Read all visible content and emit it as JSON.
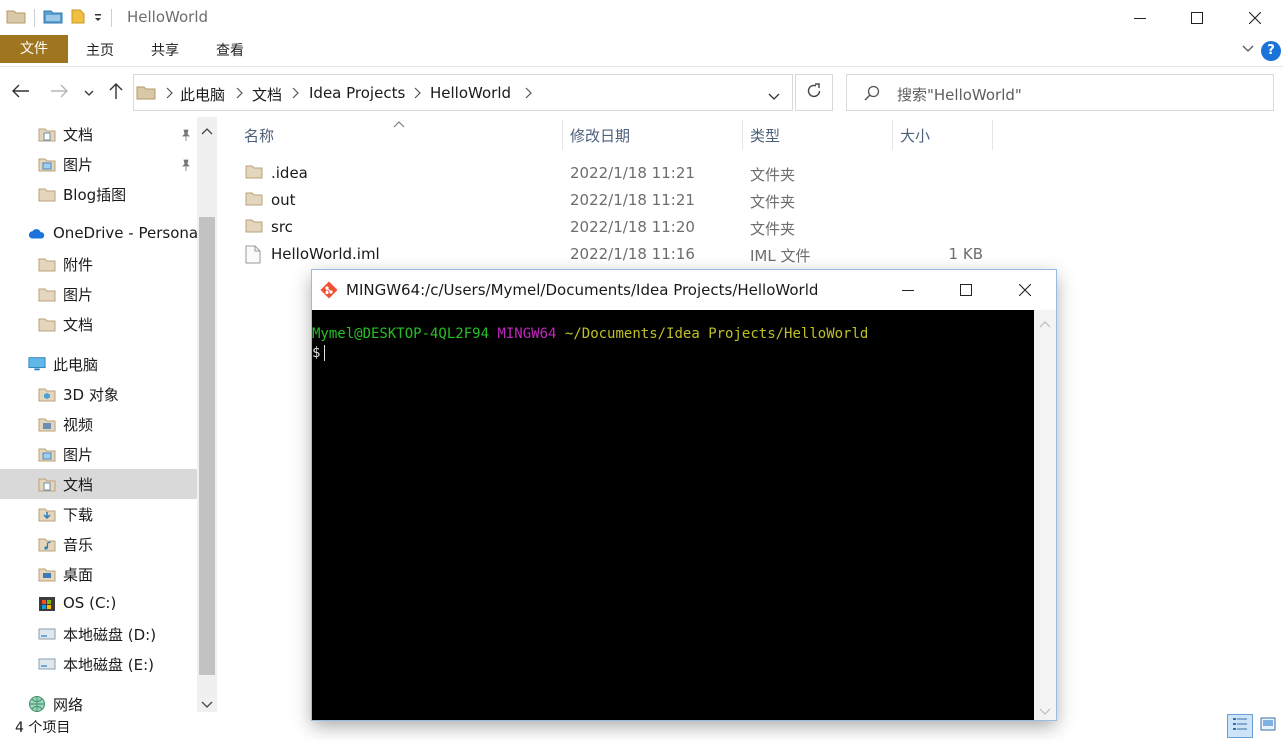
{
  "window": {
    "title": "HelloWorld",
    "controls": {
      "minimize": "—",
      "maximize": "☐",
      "close": "✕"
    }
  },
  "ribbon": {
    "tabs": [
      "文件",
      "主页",
      "共享",
      "查看"
    ],
    "help": "?"
  },
  "address": {
    "crumbs": [
      "此电脑",
      "文档",
      "Idea Projects",
      "HelloWorld"
    ],
    "search_placeholder": "搜索\"HelloWorld\""
  },
  "sidebar": {
    "items": [
      {
        "label": "文档",
        "icon": "documents-icon",
        "pinned": true
      },
      {
        "label": "图片",
        "icon": "pictures-icon",
        "pinned": true
      },
      {
        "label": "Blog插图",
        "icon": "folder-icon",
        "pinned": false
      },
      {
        "label": "OneDrive - Personal",
        "icon": "onedrive-icon"
      },
      {
        "label": "附件",
        "icon": "folder-icon"
      },
      {
        "label": "图片",
        "icon": "folder-icon"
      },
      {
        "label": "文档",
        "icon": "folder-icon"
      },
      {
        "label": "此电脑",
        "icon": "computer-icon"
      },
      {
        "label": "3D 对象",
        "icon": "3d-objects-icon"
      },
      {
        "label": "视频",
        "icon": "videos-icon"
      },
      {
        "label": "图片",
        "icon": "pictures-icon"
      },
      {
        "label": "文档",
        "icon": "documents-icon",
        "selected": true
      },
      {
        "label": "下载",
        "icon": "downloads-icon"
      },
      {
        "label": "音乐",
        "icon": "music-icon"
      },
      {
        "label": "桌面",
        "icon": "desktop-icon"
      },
      {
        "label": "OS (C:)",
        "icon": "windows-drive-icon"
      },
      {
        "label": "本地磁盘 (D:)",
        "icon": "drive-icon"
      },
      {
        "label": "本地磁盘 (E:)",
        "icon": "drive-icon"
      },
      {
        "label": "网络",
        "icon": "network-icon"
      }
    ]
  },
  "files": {
    "columns": [
      "名称",
      "修改日期",
      "类型",
      "大小"
    ],
    "rows": [
      {
        "name": ".idea",
        "date": "2022/1/18 11:21",
        "type": "文件夹",
        "size": "",
        "icon": "folder-icon"
      },
      {
        "name": "out",
        "date": "2022/1/18 11:21",
        "type": "文件夹",
        "size": "",
        "icon": "folder-icon"
      },
      {
        "name": "src",
        "date": "2022/1/18 11:20",
        "type": "文件夹",
        "size": "",
        "icon": "folder-icon"
      },
      {
        "name": "HelloWorld.iml",
        "date": "2022/1/18 11:16",
        "type": "IML 文件",
        "size": "1 KB",
        "icon": "file-icon"
      }
    ]
  },
  "status": {
    "count": "4 个项目"
  },
  "terminal": {
    "title": "MINGW64:/c/Users/Mymel/Documents/Idea Projects/HelloWorld",
    "prompt_user": "Mymel@DESKTOP-4QL2F94",
    "prompt_env": "MINGW64",
    "prompt_path": "~/Documents/Idea Projects/HelloWorld",
    "prompt_symbol": "$"
  },
  "colors": {
    "ribbon_file_tab": "#a0751f",
    "selected_nav": "#d9d9d9",
    "term_green": "#26c026",
    "term_magenta": "#c026c0",
    "term_yellow": "#c0c026"
  }
}
